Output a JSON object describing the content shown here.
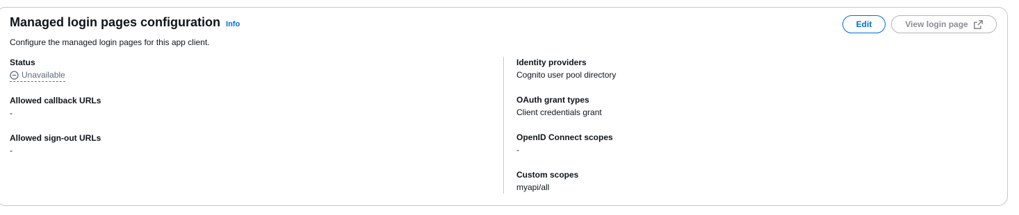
{
  "header": {
    "title": "Managed login pages configuration",
    "info_label": "Info",
    "description": "Configure the managed login pages for this app client."
  },
  "actions": {
    "edit_label": "Edit",
    "view_login_label": "View login page",
    "view_login_icon": "external-link-icon"
  },
  "left_column": {
    "status": {
      "label": "Status",
      "value": "Unavailable",
      "icon": "status-stopped-icon"
    },
    "callback_urls": {
      "label": "Allowed callback URLs",
      "value": "-"
    },
    "signout_urls": {
      "label": "Allowed sign-out URLs",
      "value": "-"
    }
  },
  "right_column": {
    "identity_providers": {
      "label": "Identity providers",
      "value": "Cognito user pool directory"
    },
    "oauth_grant_types": {
      "label": "OAuth grant types",
      "value": "Client credentials grant"
    },
    "openid_scopes": {
      "label": "OpenID Connect scopes",
      "value": "-"
    },
    "custom_scopes": {
      "label": "Custom scopes",
      "value": "myapi/all"
    }
  },
  "colors": {
    "link": "#006ce0",
    "text": "#0f141a",
    "muted": "#5f6b7a",
    "border": "#c6c6cd",
    "disabled": "#8c8c94"
  }
}
